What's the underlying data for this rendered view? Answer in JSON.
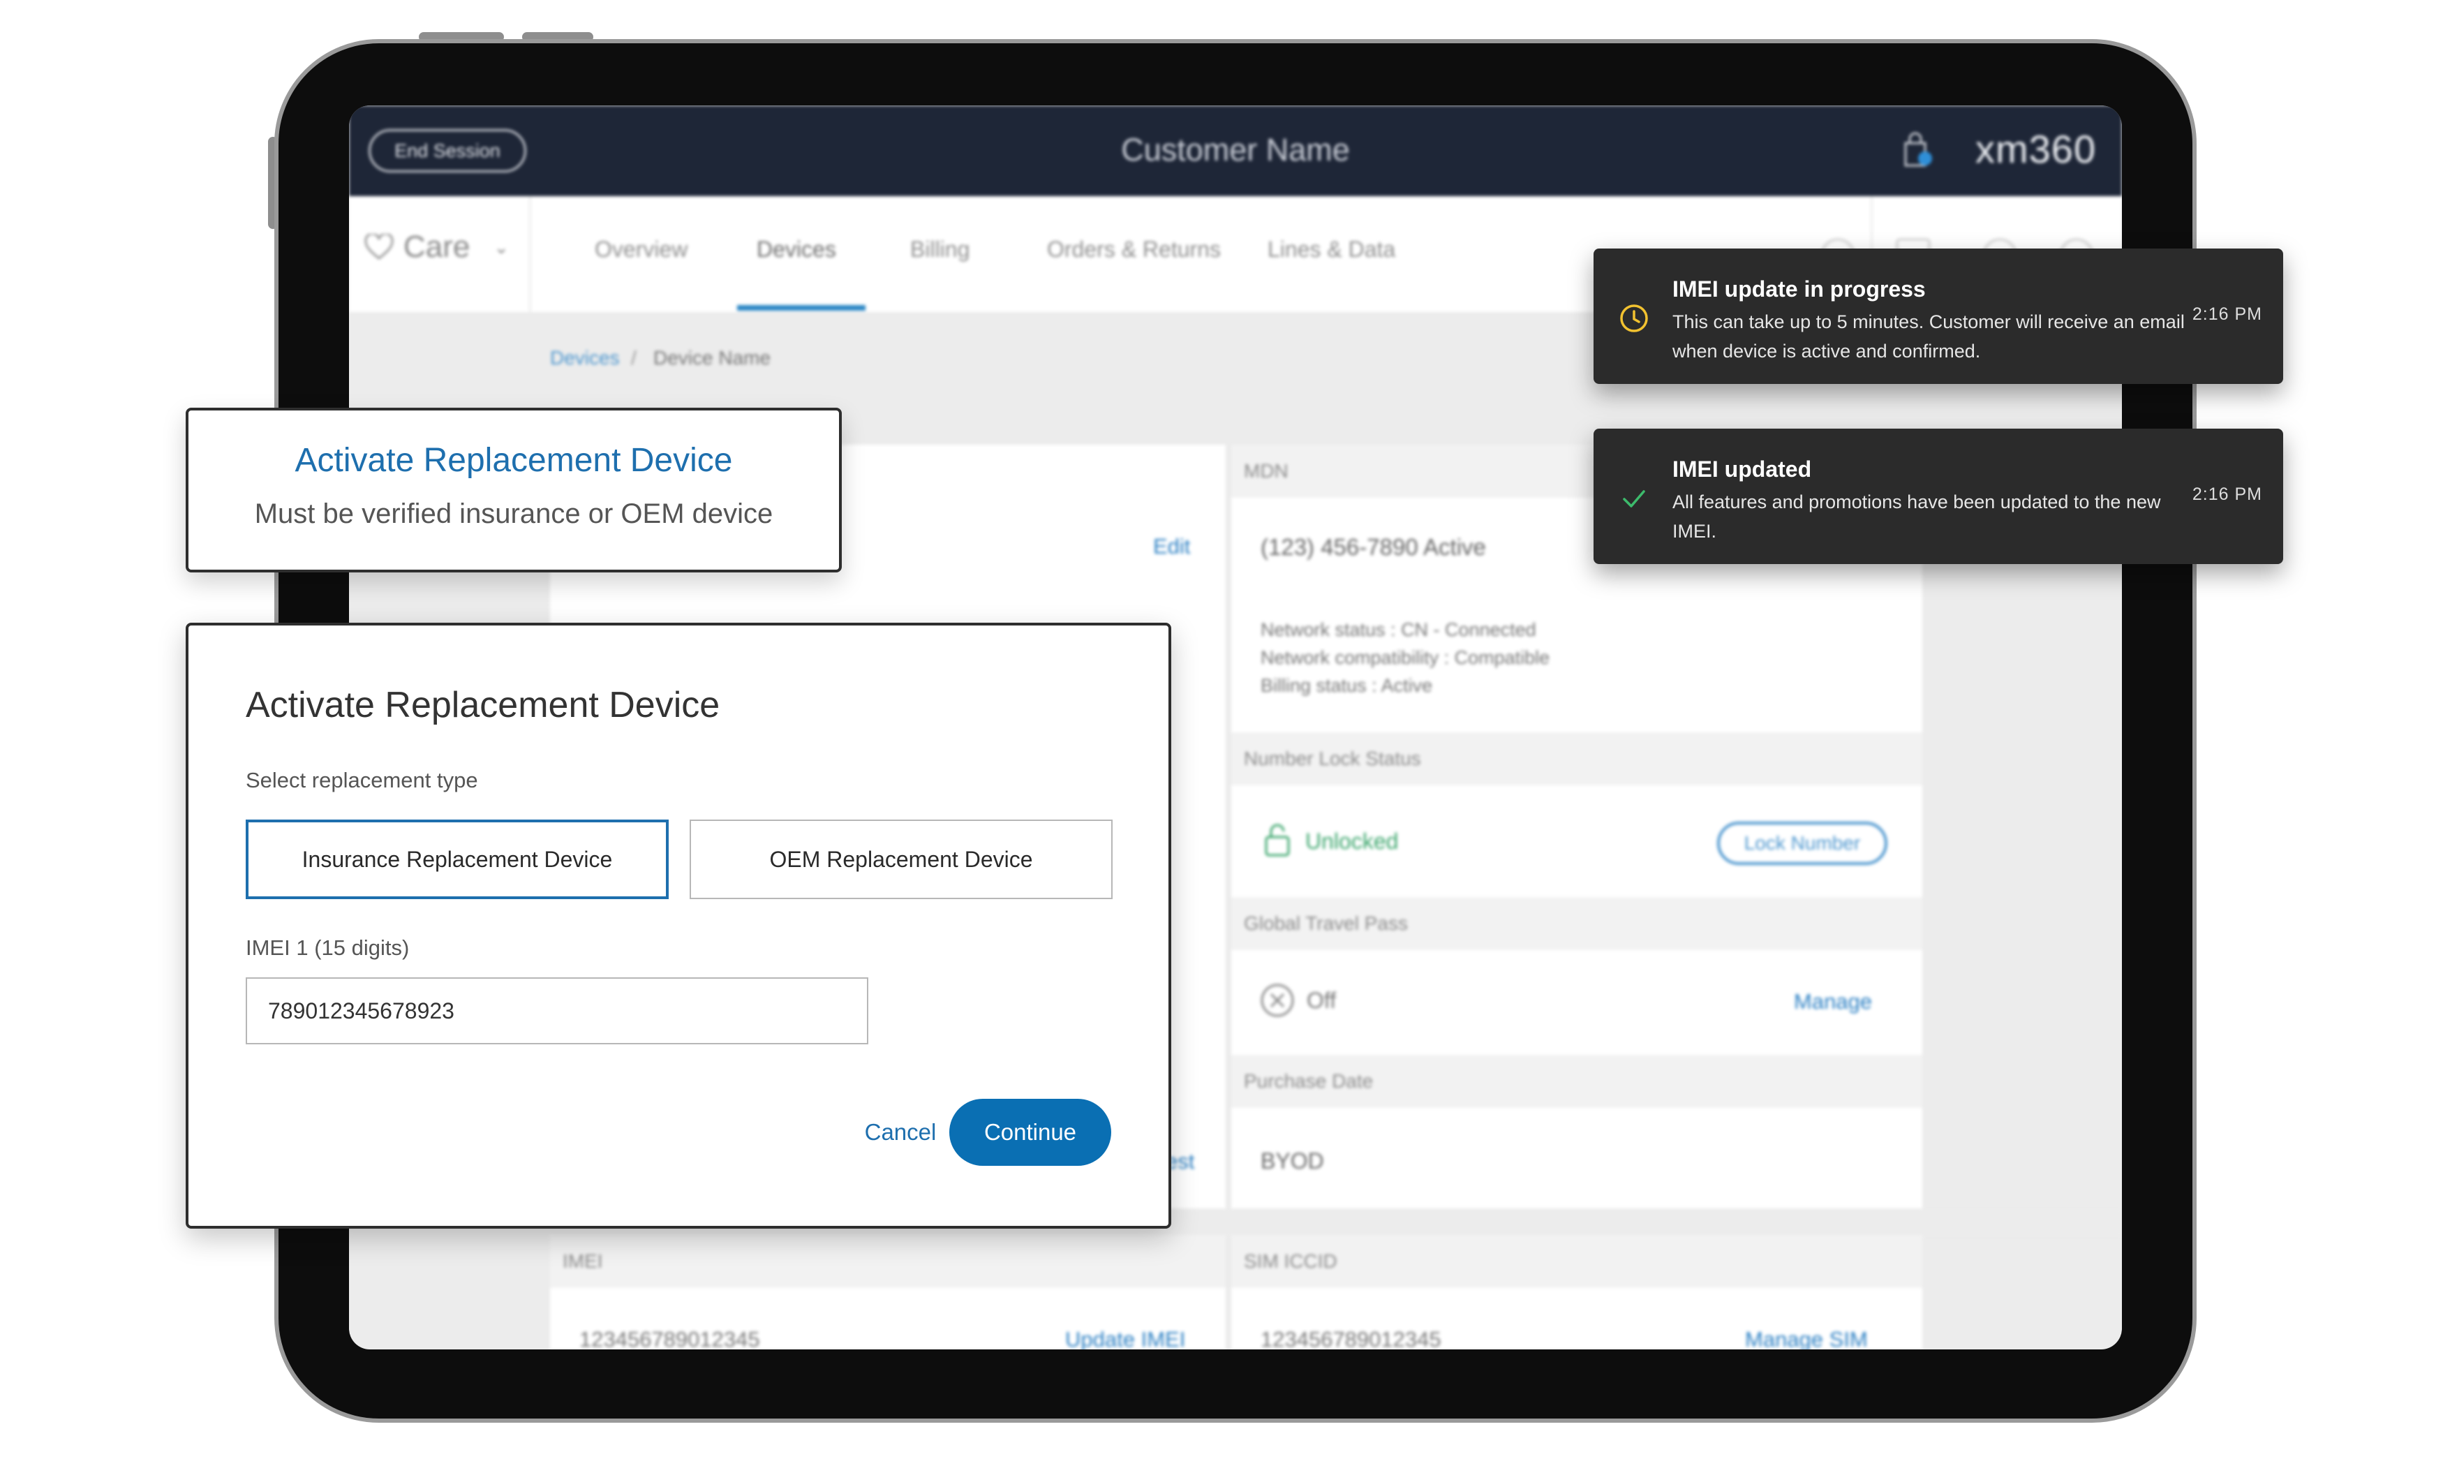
{
  "app": {
    "end_session": "End Session",
    "customer_name": "Customer Name",
    "brand": "xm360",
    "care_label": "Care"
  },
  "nav": {
    "tabs": [
      "Overview",
      "Devices",
      "Billing",
      "Orders & Returns",
      "Lines & Data"
    ],
    "active_tab": "Devices"
  },
  "breadcrumb": {
    "root": "Devices",
    "separator": "/",
    "current": "Device Name"
  },
  "device": {
    "edit_label": "Edit",
    "mdn_header": "MDN",
    "mdn_value": "(123) 456-7890  Active",
    "network_status": "Network status : CN - Connected",
    "network_compat": "Network compatibility : Compatible",
    "billing_status": "Billing status : Active",
    "number_lock_header": "Number Lock Status",
    "lock_state": "Unlocked",
    "lock_button": "Lock Number",
    "travel_header": "Global Travel Pass",
    "travel_state": "Off",
    "manage_label": "Manage",
    "purchase_header": "Purchase Date",
    "purchase_value": "BYOD",
    "partial_link": "est",
    "imei_header": "IMEI",
    "imei_value": "123456789012345",
    "update_imei": "Update IMEI",
    "sim_header": "SIM ICCID",
    "sim_value": "123456789012345",
    "manage_sim": "Manage SIM"
  },
  "toasts": [
    {
      "title": "IMEI update in progress",
      "body": "This can take up to 5 minutes. Customer will receive an email when device is active and confirmed.",
      "time": "2:16 PM",
      "icon": "clock-icon",
      "icon_color": "#f2c230"
    },
    {
      "title": "IMEI updated",
      "body": "All features and promotions have been updated to the new IMEI.",
      "time": "2:16 PM",
      "icon": "check-icon",
      "icon_color": "#3dbb6c"
    }
  ],
  "callout": {
    "title": "Activate Replacement Device",
    "subtitle": "Must be verified insurance or OEM device"
  },
  "modal": {
    "title": "Activate Replacement Device",
    "type_label": "Select replacement type",
    "options": [
      "Insurance Replacement Device",
      "OEM Replacement Device"
    ],
    "selected_option": "Insurance Replacement Device",
    "imei_label": "IMEI 1 (15 digits)",
    "imei_value": "789012345678923",
    "cancel": "Cancel",
    "continue": "Continue"
  },
  "colors": {
    "accent": "#0a6fb3",
    "topbar": "#1e2637",
    "toast_bg": "#2b2b2b",
    "unlocked_green": "#3aa56b"
  }
}
